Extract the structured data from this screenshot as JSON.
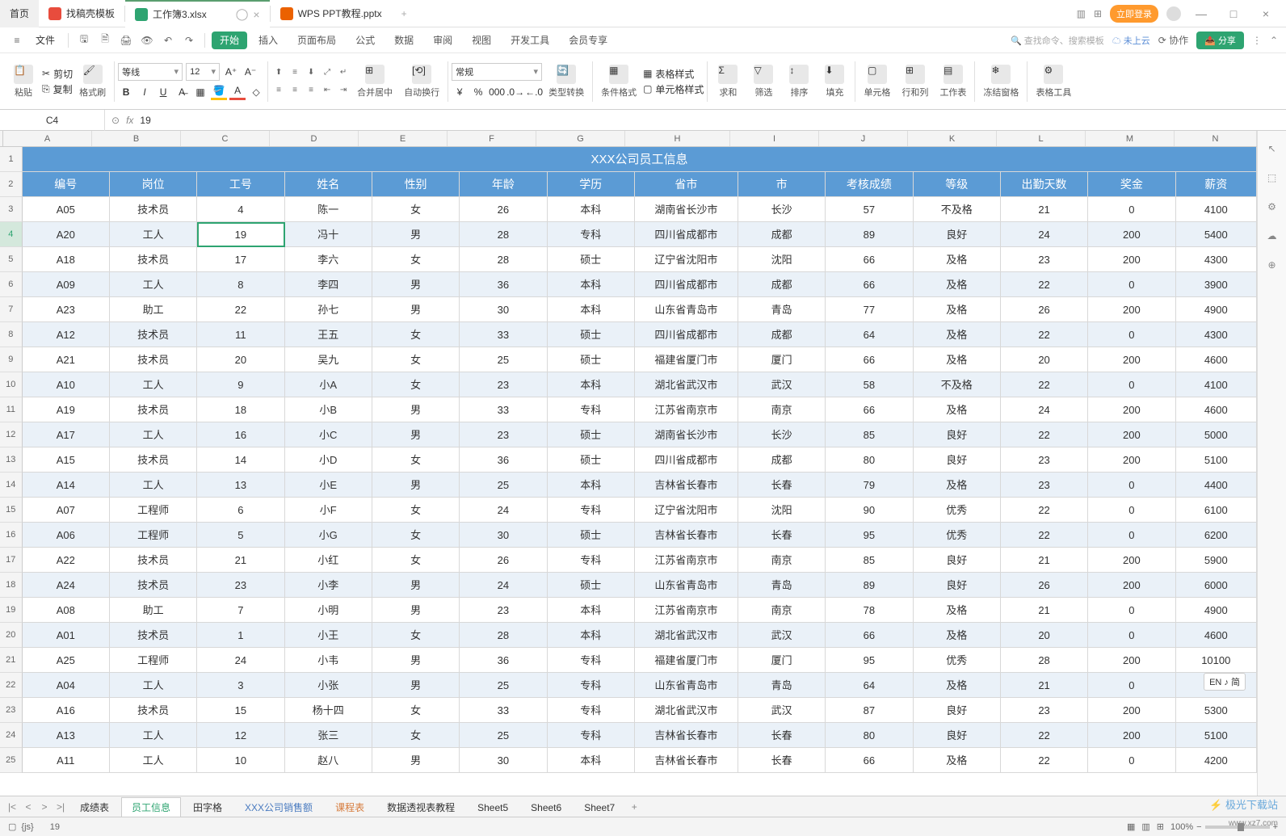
{
  "tabs": {
    "home": "首页",
    "t1": "找稿壳模板",
    "t2": "工作簿3.xlsx",
    "t3": "WPS PPT教程.pptx"
  },
  "topRight": {
    "login": "立即登录"
  },
  "menu": {
    "file": "文件",
    "tabs": [
      "开始",
      "插入",
      "页面布局",
      "公式",
      "数据",
      "审阅",
      "视图",
      "开发工具",
      "会员专享"
    ],
    "search": "查找命令、搜索模板",
    "cloud": "未上云",
    "coop": "协作",
    "share": "分享"
  },
  "ribbon": {
    "paste": "粘贴",
    "cut": "剪切",
    "copy": "复制",
    "fmtPainter": "格式刷",
    "font": "等线",
    "size": "12",
    "merge": "合并居中",
    "wrap": "自动换行",
    "numfmt": "常规",
    "typeConv": "类型转换",
    "condFmt": "条件格式",
    "tblStyle": "表格样式",
    "cellStyle": "单元格样式",
    "sum": "求和",
    "filter": "筛选",
    "sort": "排序",
    "fill": "填充",
    "cell": "单元格",
    "rowcol": "行和列",
    "sheet": "工作表",
    "freeze": "冻结窗格",
    "tblTools": "表格工具"
  },
  "nameBox": "C4",
  "formulaBar": "19",
  "columns": [
    "A",
    "B",
    "C",
    "D",
    "E",
    "F",
    "G",
    "H",
    "I",
    "J",
    "K",
    "L",
    "M",
    "N"
  ],
  "titleRow": "XXX公司员工信息",
  "headers": [
    "编号",
    "岗位",
    "工号",
    "姓名",
    "性别",
    "年龄",
    "学历",
    "省市",
    "市",
    "考核成绩",
    "等级",
    "出勤天数",
    "奖金",
    "薪资"
  ],
  "rows": [
    [
      "A05",
      "技术员",
      "4",
      "陈一",
      "女",
      "26",
      "本科",
      "湖南省长沙市",
      "长沙",
      "57",
      "不及格",
      "21",
      "0",
      "4100"
    ],
    [
      "A20",
      "工人",
      "19",
      "冯十",
      "男",
      "28",
      "专科",
      "四川省成都市",
      "成都",
      "89",
      "良好",
      "24",
      "200",
      "5400"
    ],
    [
      "A18",
      "技术员",
      "17",
      "李六",
      "女",
      "28",
      "硕士",
      "辽宁省沈阳市",
      "沈阳",
      "66",
      "及格",
      "23",
      "200",
      "4300"
    ],
    [
      "A09",
      "工人",
      "8",
      "李四",
      "男",
      "36",
      "本科",
      "四川省成都市",
      "成都",
      "66",
      "及格",
      "22",
      "0",
      "3900"
    ],
    [
      "A23",
      "助工",
      "22",
      "孙七",
      "男",
      "30",
      "本科",
      "山东省青岛市",
      "青岛",
      "77",
      "及格",
      "26",
      "200",
      "4900"
    ],
    [
      "A12",
      "技术员",
      "11",
      "王五",
      "女",
      "33",
      "硕士",
      "四川省成都市",
      "成都",
      "64",
      "及格",
      "22",
      "0",
      "4300"
    ],
    [
      "A21",
      "技术员",
      "20",
      "吴九",
      "女",
      "25",
      "硕士",
      "福建省厦门市",
      "厦门",
      "66",
      "及格",
      "20",
      "200",
      "4600"
    ],
    [
      "A10",
      "工人",
      "9",
      "小A",
      "女",
      "23",
      "本科",
      "湖北省武汉市",
      "武汉",
      "58",
      "不及格",
      "22",
      "0",
      "4100"
    ],
    [
      "A19",
      "技术员",
      "18",
      "小B",
      "男",
      "33",
      "专科",
      "江苏省南京市",
      "南京",
      "66",
      "及格",
      "24",
      "200",
      "4600"
    ],
    [
      "A17",
      "工人",
      "16",
      "小C",
      "男",
      "23",
      "硕士",
      "湖南省长沙市",
      "长沙",
      "85",
      "良好",
      "22",
      "200",
      "5000"
    ],
    [
      "A15",
      "技术员",
      "14",
      "小D",
      "女",
      "36",
      "硕士",
      "四川省成都市",
      "成都",
      "80",
      "良好",
      "23",
      "200",
      "5100"
    ],
    [
      "A14",
      "工人",
      "13",
      "小E",
      "男",
      "25",
      "本科",
      "吉林省长春市",
      "长春",
      "79",
      "及格",
      "23",
      "0",
      "4400"
    ],
    [
      "A07",
      "工程师",
      "6",
      "小F",
      "女",
      "24",
      "专科",
      "辽宁省沈阳市",
      "沈阳",
      "90",
      "优秀",
      "22",
      "0",
      "6100"
    ],
    [
      "A06",
      "工程师",
      "5",
      "小G",
      "女",
      "30",
      "硕士",
      "吉林省长春市",
      "长春",
      "95",
      "优秀",
      "22",
      "0",
      "6200"
    ],
    [
      "A22",
      "技术员",
      "21",
      "小红",
      "女",
      "26",
      "专科",
      "江苏省南京市",
      "南京",
      "85",
      "良好",
      "21",
      "200",
      "5900"
    ],
    [
      "A24",
      "技术员",
      "23",
      "小李",
      "男",
      "24",
      "硕士",
      "山东省青岛市",
      "青岛",
      "89",
      "良好",
      "26",
      "200",
      "6000"
    ],
    [
      "A08",
      "助工",
      "7",
      "小明",
      "男",
      "23",
      "本科",
      "江苏省南京市",
      "南京",
      "78",
      "及格",
      "21",
      "0",
      "4900"
    ],
    [
      "A01",
      "技术员",
      "1",
      "小王",
      "女",
      "28",
      "本科",
      "湖北省武汉市",
      "武汉",
      "66",
      "及格",
      "20",
      "0",
      "4600"
    ],
    [
      "A25",
      "工程师",
      "24",
      "小韦",
      "男",
      "36",
      "专科",
      "福建省厦门市",
      "厦门",
      "95",
      "优秀",
      "28",
      "200",
      "10100"
    ],
    [
      "A04",
      "工人",
      "3",
      "小张",
      "男",
      "25",
      "专科",
      "山东省青岛市",
      "青岛",
      "64",
      "及格",
      "21",
      "0",
      "4100"
    ],
    [
      "A16",
      "技术员",
      "15",
      "杨十四",
      "女",
      "33",
      "专科",
      "湖北省武汉市",
      "武汉",
      "87",
      "良好",
      "23",
      "200",
      "5300"
    ],
    [
      "A13",
      "工人",
      "12",
      "张三",
      "女",
      "25",
      "专科",
      "吉林省长春市",
      "长春",
      "80",
      "良好",
      "22",
      "200",
      "5100"
    ],
    [
      "A11",
      "工人",
      "10",
      "赵八",
      "男",
      "30",
      "本科",
      "吉林省长春市",
      "长春",
      "66",
      "及格",
      "22",
      "0",
      "4200"
    ]
  ],
  "sheetTabs": [
    "成绩表",
    "员工信息",
    "田字格",
    "XXX公司销售额",
    "课程表",
    "数据透视表教程",
    "Sheet5",
    "Sheet6",
    "Sheet7"
  ],
  "status": {
    "val": "19",
    "zoom": "100%",
    "watermark": "极光下载站",
    "url": "www.xz7.com",
    "ime": "EN ♪ 简"
  }
}
